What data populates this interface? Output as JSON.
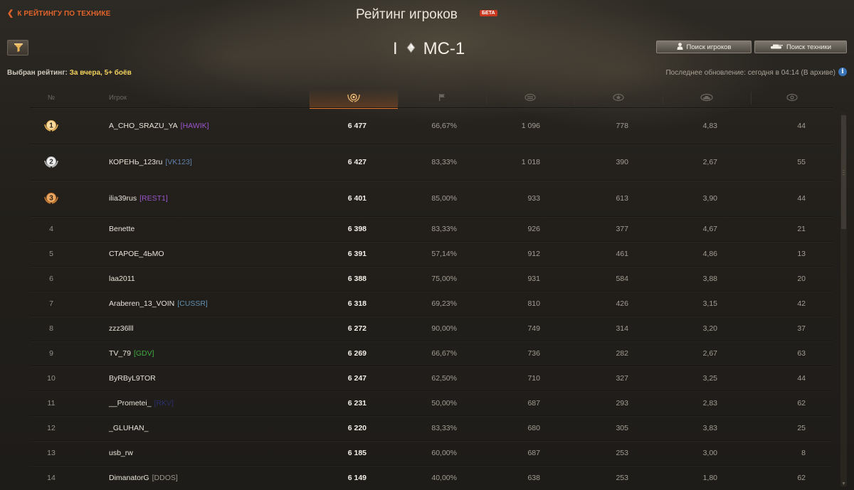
{
  "header": {
    "back_link": "К РЕЙТИНГУ ПО ТЕХНИКЕ",
    "title": "Рейтинг игроков",
    "beta_badge": "БЕТА"
  },
  "tank": {
    "tier": "I",
    "type_icon": "light-tank-diamond-icon",
    "name": "МС-1"
  },
  "toolbar": {
    "filter_icon": "filter-icon",
    "find_players_label": "Поиск игроков",
    "find_players_icon": "person-icon",
    "find_vehicles_label": "Поиск техники",
    "find_vehicles_icon": "tank-icon"
  },
  "rating_filter": {
    "label": "Выбран рейтинг:",
    "value": "За вчера, 5+ боёв"
  },
  "last_update": {
    "text": "Последнее обновление: сегодня в 04:14 (В архиве)",
    "info_icon": "info-icon"
  },
  "table": {
    "columns": [
      {
        "key": "rank",
        "label": "№",
        "icon": ""
      },
      {
        "key": "player",
        "label": "Игрок",
        "icon": ""
      },
      {
        "key": "score",
        "label": "",
        "icon": "rating-laurel-icon",
        "active": true
      },
      {
        "key": "winrate",
        "label": "",
        "icon": "flag-icon"
      },
      {
        "key": "damage",
        "label": "",
        "icon": "damage-arrows-icon"
      },
      {
        "key": "experience",
        "label": "",
        "icon": "star-icon"
      },
      {
        "key": "kills",
        "label": "",
        "icon": "destroyed-tank-icon"
      },
      {
        "key": "spotted",
        "label": "",
        "icon": "spotting-icon"
      }
    ],
    "rows": [
      {
        "rank": "1",
        "medal": "gold",
        "player": "A_CHO_SRAZU_YA",
        "clan": "[HAWIK]",
        "clan_color": "#9a55c9",
        "score": "6 477",
        "winrate": "66,67%",
        "damage": "1 096",
        "experience": "778",
        "kills": "4,83",
        "spotted": "44"
      },
      {
        "rank": "2",
        "medal": "silver",
        "player": "КОРЕНЬ_123ru",
        "clan": "[VK123]",
        "clan_color": "#5f7fa8",
        "score": "6 427",
        "winrate": "83,33%",
        "damage": "1 018",
        "experience": "390",
        "kills": "2,67",
        "spotted": "55"
      },
      {
        "rank": "3",
        "medal": "bronze",
        "player": "ilia39rus",
        "clan": "[REST1]",
        "clan_color": "#9a55c9",
        "score": "6 401",
        "winrate": "85,00%",
        "damage": "933",
        "experience": "613",
        "kills": "3,90",
        "spotted": "44"
      },
      {
        "rank": "4",
        "medal": "",
        "player": "Benette",
        "clan": "",
        "clan_color": "",
        "score": "6 398",
        "winrate": "83,33%",
        "damage": "926",
        "experience": "377",
        "kills": "4,67",
        "spotted": "21"
      },
      {
        "rank": "5",
        "medal": "",
        "player": "СТАРОЕ_4ЬМО",
        "clan": "",
        "clan_color": "",
        "score": "6 391",
        "winrate": "57,14%",
        "damage": "912",
        "experience": "461",
        "kills": "4,86",
        "spotted": "13"
      },
      {
        "rank": "6",
        "medal": "",
        "player": "laa2011",
        "clan": "",
        "clan_color": "",
        "score": "6 388",
        "winrate": "75,00%",
        "damage": "931",
        "experience": "584",
        "kills": "3,88",
        "spotted": "20"
      },
      {
        "rank": "7",
        "medal": "",
        "player": "Araberen_13_VOIN",
        "clan": "[CUSSR]",
        "clan_color": "#5f8fb0",
        "score": "6 318",
        "winrate": "69,23%",
        "damage": "810",
        "experience": "426",
        "kills": "3,15",
        "spotted": "42"
      },
      {
        "rank": "8",
        "medal": "",
        "player": "zzz36lll",
        "clan": "",
        "clan_color": "",
        "score": "6 272",
        "winrate": "90,00%",
        "damage": "749",
        "experience": "314",
        "kills": "3,20",
        "spotted": "37"
      },
      {
        "rank": "9",
        "medal": "",
        "player": "TV_79",
        "clan": "[GDV]",
        "clan_color": "#3fa83f",
        "score": "6 269",
        "winrate": "66,67%",
        "damage": "736",
        "experience": "282",
        "kills": "2,67",
        "spotted": "63"
      },
      {
        "rank": "10",
        "medal": "",
        "player": "ByRByL9TOR",
        "clan": "",
        "clan_color": "",
        "score": "6 247",
        "winrate": "62,50%",
        "damage": "710",
        "experience": "327",
        "kills": "3,25",
        "spotted": "44"
      },
      {
        "rank": "11",
        "medal": "",
        "player": "__Prometei_",
        "clan": "[RKV]",
        "clan_color": "#2b2f6a",
        "score": "6 231",
        "winrate": "50,00%",
        "damage": "687",
        "experience": "293",
        "kills": "2,83",
        "spotted": "62"
      },
      {
        "rank": "12",
        "medal": "",
        "player": "_GLUHAN_",
        "clan": "",
        "clan_color": "",
        "score": "6 220",
        "winrate": "83,33%",
        "damage": "680",
        "experience": "305",
        "kills": "3,83",
        "spotted": "25"
      },
      {
        "rank": "13",
        "medal": "",
        "player": "usb_rw",
        "clan": "",
        "clan_color": "",
        "score": "6 185",
        "winrate": "60,00%",
        "damage": "687",
        "experience": "253",
        "kills": "3,00",
        "spotted": "8"
      },
      {
        "rank": "14",
        "medal": "",
        "player": "DimanatorG",
        "clan": "[DDOS]",
        "clan_color": "#9a948a",
        "score": "6 149",
        "winrate": "40,00%",
        "damage": "638",
        "experience": "253",
        "kills": "1,80",
        "spotted": "62"
      }
    ]
  },
  "colors": {
    "accent_orange": "#e5762a",
    "filter_value_yellow": "#f3d35e",
    "beta_red": "#c9381f",
    "info_blue": "#3a74b8"
  }
}
